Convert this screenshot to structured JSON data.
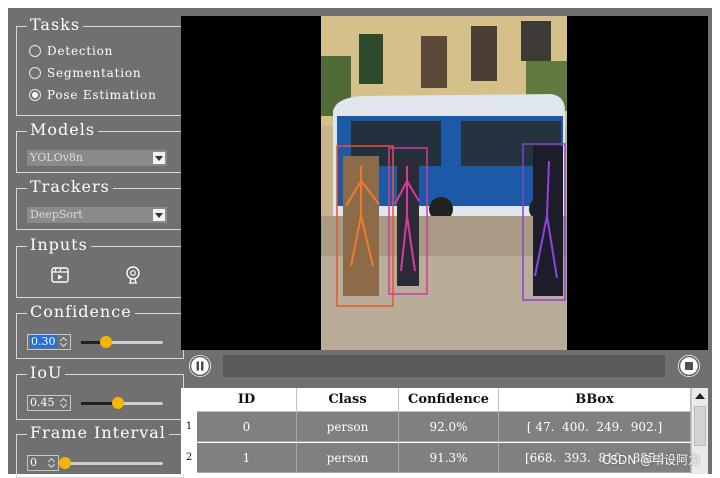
{
  "tasks": {
    "title": "Tasks",
    "options": [
      {
        "label": "Detection",
        "selected": false
      },
      {
        "label": "Segmentation",
        "selected": false
      },
      {
        "label": "Pose Estimation",
        "selected": true
      }
    ]
  },
  "models": {
    "title": "Models",
    "selected": "YOLOv8n"
  },
  "trackers": {
    "title": "Trackers",
    "selected": "DeepSort"
  },
  "inputs": {
    "title": "Inputs",
    "icons": [
      "video-file-icon",
      "webcam-icon"
    ]
  },
  "confidence": {
    "title": "Confidence",
    "value": "0.30",
    "level": 0.3
  },
  "iou": {
    "title": "IoU",
    "value": "0.45",
    "level": 0.45
  },
  "frame_interval": {
    "title": "Frame Interval",
    "value": "0",
    "level": 0.0
  },
  "controls": {
    "play_pause_icon": "pause-icon",
    "stop_icon": "stop-icon",
    "progress": 0.0
  },
  "table": {
    "columns": [
      "ID",
      "Class",
      "Confidence",
      "BBox"
    ],
    "rows": [
      {
        "num": "1",
        "id": "0",
        "cls": "person",
        "conf": "92.0%",
        "bbox": "[ 47.  400.  249.  902.]"
      },
      {
        "num": "2",
        "id": "1",
        "cls": "person",
        "conf": "91.3%",
        "bbox": "[668.  393.  810.  885.]"
      }
    ]
  },
  "watermark": "CSDN @毕设阿力",
  "colors": {
    "panel": "#707070",
    "accent": "#f5b500",
    "row": "#808080"
  }
}
